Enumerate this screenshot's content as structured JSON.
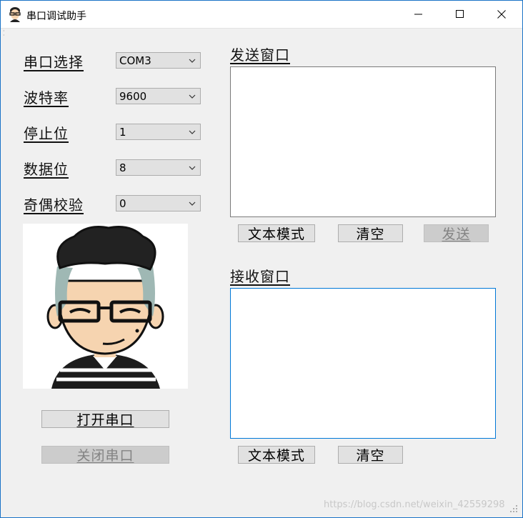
{
  "window": {
    "title": "串口调试助手",
    "icon": "avatar-icon",
    "controls": [
      "minimize-icon",
      "maximize-icon",
      "close-icon"
    ]
  },
  "settings": {
    "port": {
      "label": "串口选择",
      "value": "COM3"
    },
    "baud": {
      "label": "波特率",
      "value": "9600"
    },
    "stop_bits": {
      "label": "停止位",
      "value": "1"
    },
    "data_bits": {
      "label": "数据位",
      "value": "8"
    },
    "parity": {
      "label": "奇偶校验",
      "value": "0"
    }
  },
  "buttons": {
    "open_port": "打开串口",
    "close_port": "关闭串口"
  },
  "send": {
    "title": "发送窗口",
    "text": "",
    "mode_button": "文本模式",
    "clear_button": "清空",
    "send_button": "发送"
  },
  "receive": {
    "title": "接收窗口",
    "text": "",
    "mode_button": "文本模式",
    "clear_button": "清空"
  },
  "watermark": "https://blog.csdn.net/weixin_42559298",
  "colors": {
    "accent": "#0078d7",
    "background": "#f0f0f0",
    "disabled_text": "#838383"
  }
}
